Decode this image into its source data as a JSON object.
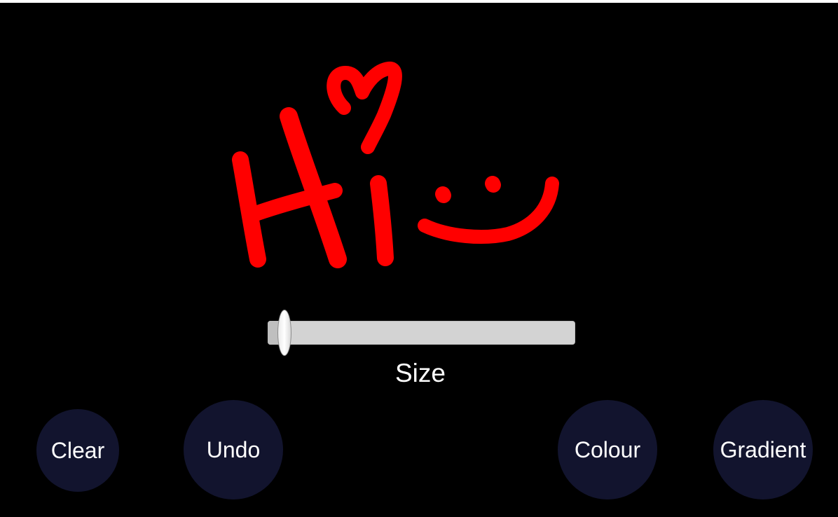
{
  "canvas": {
    "stroke_color": "#ff0000",
    "background_color": "#000000"
  },
  "size_slider": {
    "label": "Size",
    "value_fraction": 0.03
  },
  "buttons": {
    "clear": "Clear",
    "undo": "Undo",
    "colour": "Colour",
    "gradient": "Gradient",
    "button_color": "#12142e"
  }
}
